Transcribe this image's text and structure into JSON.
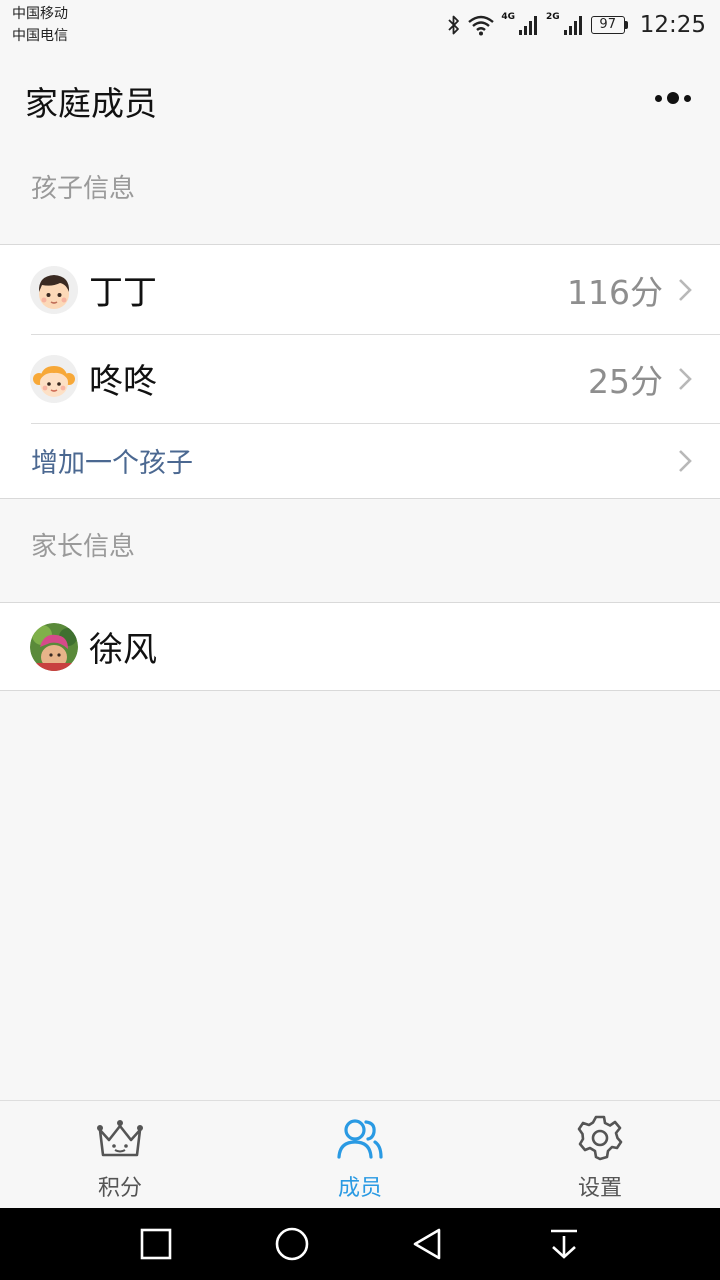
{
  "status_bar": {
    "carrier_1": "中国移动",
    "carrier_2": "中国电信",
    "network_1": "4G",
    "network_2": "2G",
    "battery": "97",
    "time": "12:25",
    "icons": [
      "bluetooth-icon",
      "wifi-icon",
      "signal-icon",
      "signal-icon",
      "battery-icon"
    ]
  },
  "header": {
    "title": "家庭成员",
    "more_icon": "more-dots-icon"
  },
  "children_section": {
    "label": "孩子信息",
    "items": [
      {
        "name": "丁丁",
        "score": "116分",
        "avatar": "boy-avatar"
      },
      {
        "name": "咚咚",
        "score": "25分",
        "avatar": "girl-avatar"
      }
    ],
    "add_label": "增加一个孩子"
  },
  "parents_section": {
    "label": "家长信息",
    "items": [
      {
        "name": "徐风",
        "avatar": "photo-avatar"
      }
    ]
  },
  "tab_bar": {
    "active_color": "#2a9ae3",
    "tabs": [
      {
        "label": "积分",
        "icon": "crown-icon",
        "active": false
      },
      {
        "label": "成员",
        "icon": "members-icon",
        "active": true
      },
      {
        "label": "设置",
        "icon": "gear-icon",
        "active": false
      }
    ]
  },
  "nav_bar": {
    "icons": [
      "recents-square-icon",
      "home-circle-icon",
      "back-triangle-icon",
      "notification-pull-icon"
    ]
  }
}
